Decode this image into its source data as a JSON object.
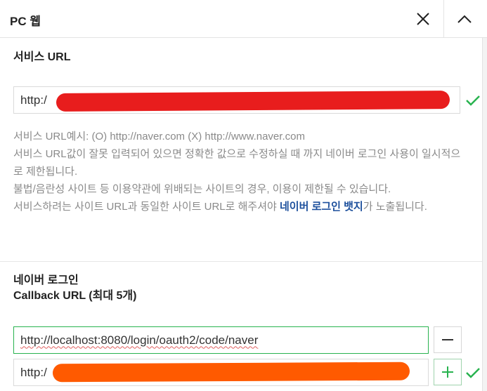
{
  "header": {
    "title": "PC 웹",
    "close_icon": "close-icon",
    "collapse_icon": "chevron-up-icon"
  },
  "service_url": {
    "title": "서비스 URL",
    "value": "http:/"
  },
  "help": {
    "line1": "서비스 URL예시: (O) http://naver.com (X) http://www.naver.com",
    "line2": "서비스 URL값이 잘못 입력되어 있으면 정확한 값으로 수정하실 때 까지 네이버 로그인 사용이 일시적으로 제한됩니다.",
    "line3": "불법/음란성 사이트 등 이용약관에 위배되는 사이트의 경우, 이용이 제한될 수 있습니다.",
    "line4_before": "서비스하려는 사이트 URL과 동일한 사이트 URL로 해주셔야 ",
    "line4_strong": "네이버 로그인 뱃지",
    "line4_after": "가 노출됩니다."
  },
  "callback": {
    "title_line1": "네이버 로그인",
    "title_line2": "Callback URL (최대 5개)",
    "url1": "http://localhost:8080/login/oauth2/code/naver",
    "url2": "http:/"
  },
  "colors": {
    "accent_green": "#28b34f",
    "link_blue": "#1c4f9c",
    "redact_red": "#e81d1d",
    "redact_orange": "#ff5a00"
  }
}
